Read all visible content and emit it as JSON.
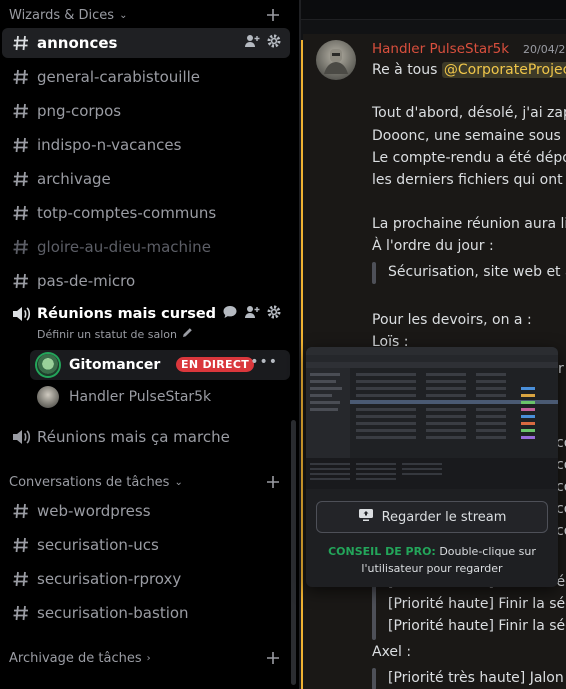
{
  "server": {
    "categories": [
      {
        "label": "Wizards & Dices"
      },
      {
        "label": "Conversations de tâches"
      },
      {
        "label": "Archivage de tâches"
      }
    ]
  },
  "channels": {
    "annonces": "annonces",
    "general": "general-carabistouille",
    "png": "png-corpos",
    "indispo": "indispo-n-vacances",
    "archivage": "archivage",
    "totp": "totp-comptes-communs",
    "gloire": "gloire-au-dieu-machine",
    "pasdemicro": "pas-de-micro",
    "web": "web-wordpress",
    "ucs": "securisation-ucs",
    "rproxy": "securisation-rproxy",
    "bastion": "securisation-bastion"
  },
  "voice": {
    "cursed": {
      "name": "Réunions mais cursed",
      "status_hint": "Définir un statut de salon",
      "users": [
        {
          "name": "Gitomancer",
          "badge": "EN DIRECT"
        },
        {
          "name": "Handler PulseStar5k"
        }
      ]
    },
    "marche": {
      "name": "Réunions mais ça marche"
    }
  },
  "message": {
    "author": "Handler PulseStar5k",
    "time": "20/04/2",
    "greeting": "Re à tous ",
    "mention": "@CorporateProjec",
    "l1": "Tout d'abord, désolé, j'ai zapp",
    "l2": "Dooonc, une semaine sous le",
    "l3": "Le compte-rendu a été dépo",
    "l4": "les derniers fichiers qui ont é",
    "l5": "La prochaine réunion aura lie",
    "l6": "À l'ordre du jour :",
    "q1": "Sécurisation, site web et a",
    "l7": "Pour les devoirs, on a :",
    "l8": "Loïs :",
    "r1": "r",
    "r2": "co",
    "r3": "co",
    "r4": "co",
    "r5": "co",
    "r6": "co",
    "q2": "[Priorité haute] Finir la séc",
    "q3": "[Priorité haute] Finir la séc",
    "q4": "[Priorité haute] Finir la séc",
    "l9": "Axel :",
    "q5": "[Priorité très haute] Jalon"
  },
  "popup": {
    "watch_label": "Regarder le stream",
    "tip_label": "CONSEIL DE PRO:",
    "tip_text": " Double-clique sur l'utilisateur pour regarder"
  },
  "colors": {
    "live": "#da373c",
    "protip": "#23a55a",
    "author": "#d94f3d",
    "mention": "#f0c64a",
    "highlight_bar": "#f0b232"
  }
}
